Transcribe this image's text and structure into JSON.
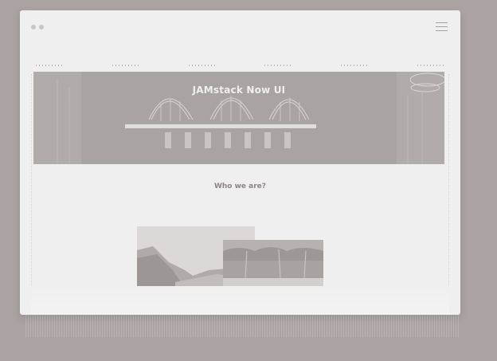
{
  "hero": {
    "title": "JAMstack Now UI"
  },
  "about": {
    "heading": "Who we are?"
  },
  "nav": {
    "items": [
      "",
      "",
      "",
      "",
      "",
      ""
    ]
  },
  "icons": {
    "menu": "hamburger-menu-icon",
    "window_controls": [
      "window-dot-icon",
      "window-dot-icon"
    ]
  },
  "colors": {
    "background": "#aaa3a1",
    "window": "#efefef",
    "hero_overlay": "#a9a3a1",
    "hero_text": "#efefef",
    "heading_text": "#8c8584"
  }
}
